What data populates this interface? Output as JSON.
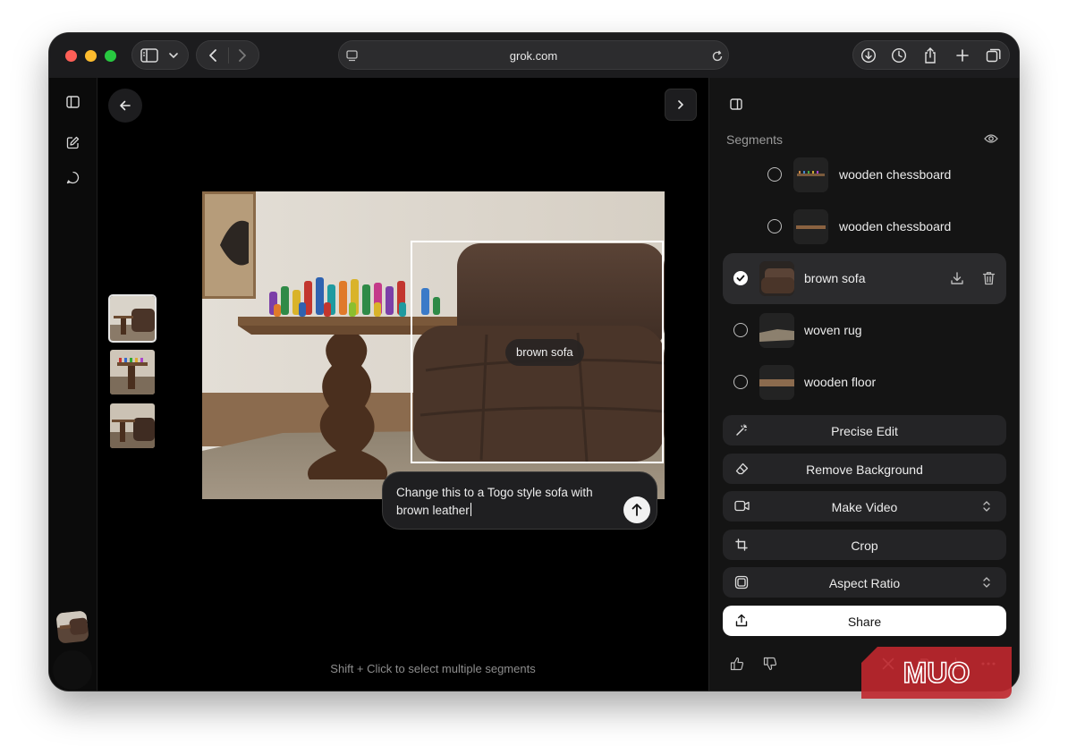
{
  "browser": {
    "url": "grok.com"
  },
  "canvas": {
    "segment_tag": "brown sofa",
    "prompt_text": "Change this to a Togo style sofa with brown leather",
    "hint": "Shift + Click to select multiple segments"
  },
  "panel": {
    "title": "Segments",
    "segments": [
      {
        "label": "wooden chessboard",
        "selected": false
      },
      {
        "label": "wooden chessboard",
        "selected": false
      },
      {
        "label": "brown sofa",
        "selected": true
      },
      {
        "label": "woven rug",
        "selected": false
      },
      {
        "label": "wooden floor",
        "selected": false
      }
    ],
    "actions": [
      {
        "label": "Precise Edit",
        "icon": "magic-wand-icon"
      },
      {
        "label": "Remove Background",
        "icon": "eraser-icon"
      },
      {
        "label": "Make Video",
        "icon": "video-icon"
      },
      {
        "label": "Crop",
        "icon": "crop-icon"
      },
      {
        "label": "Aspect Ratio",
        "icon": "aspect-ratio-icon"
      },
      {
        "label": "Share",
        "icon": "share-icon"
      }
    ]
  },
  "watermark": {
    "text": "MUO"
  }
}
